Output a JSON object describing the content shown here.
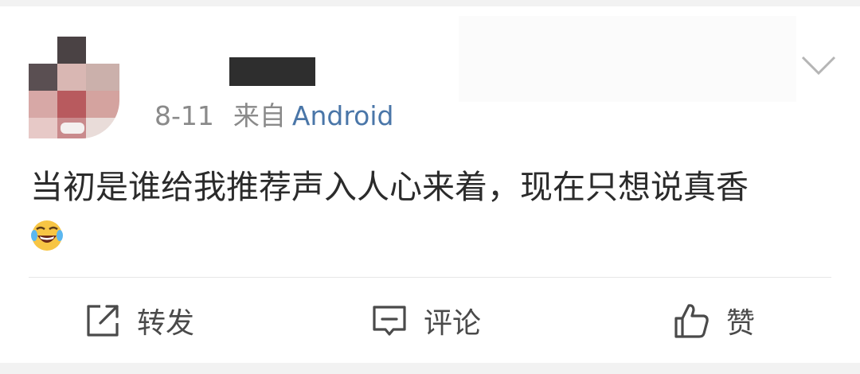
{
  "post": {
    "date": "8-11",
    "source_prefix": "来自",
    "source_device": "Android",
    "text": "当初是谁给我推荐声入人心来着，现在只想说真香",
    "emoji": "grinning-tears-emoji"
  },
  "actions": {
    "repost_label": "转发",
    "comment_label": "评论",
    "like_label": "赞"
  },
  "colors": {
    "source_link": "#4a76a8",
    "meta_gray": "#8a8a8a",
    "body_text": "#2b2b2b",
    "action_text": "#4a4a4a",
    "background": "#f2f2f2"
  },
  "icons": [
    "avatar-pixelated",
    "chevron-down-icon",
    "repost-icon",
    "comment-icon",
    "like-icon"
  ]
}
